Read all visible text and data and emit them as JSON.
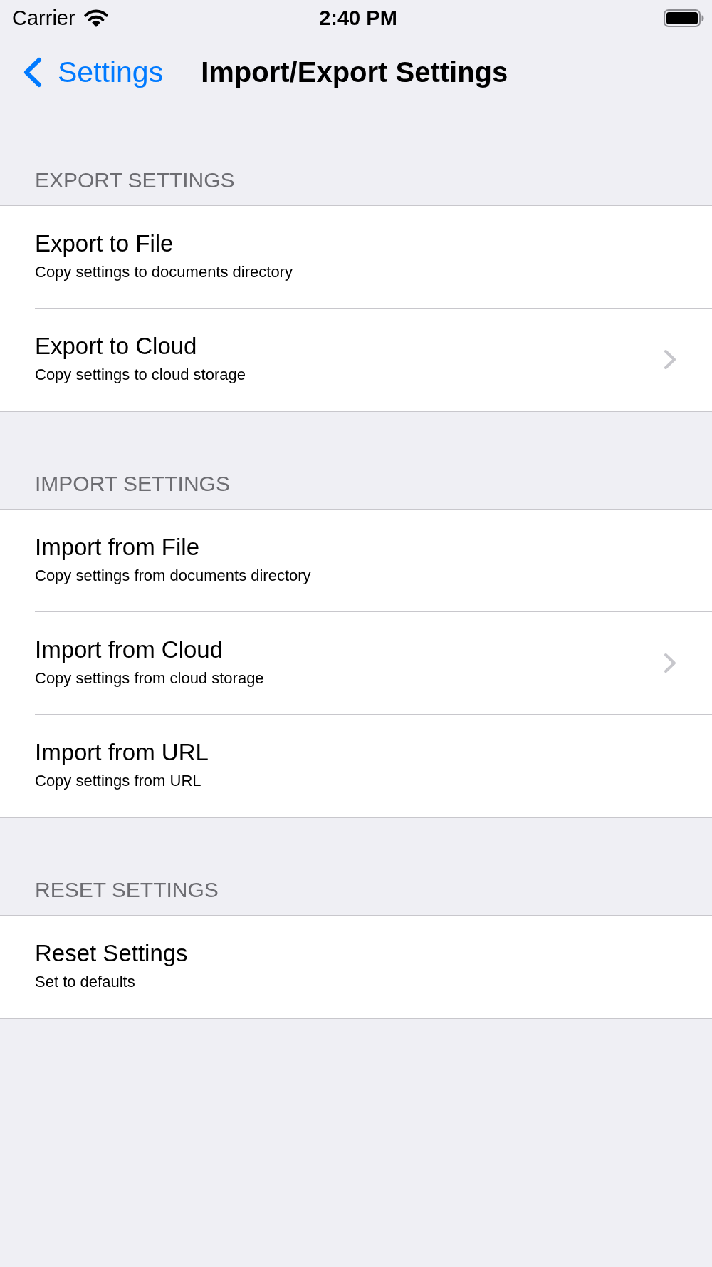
{
  "status_bar": {
    "carrier": "Carrier",
    "time": "2:40 PM"
  },
  "nav_bar": {
    "back_label": "Settings",
    "title": "Import/Export Settings"
  },
  "sections": [
    {
      "header": "EXPORT SETTINGS",
      "rows": [
        {
          "title": "Export to File",
          "subtitle": "Copy settings to documents directory",
          "disclosure": false
        },
        {
          "title": "Export to Cloud",
          "subtitle": "Copy settings to cloud storage",
          "disclosure": true
        }
      ]
    },
    {
      "header": "IMPORT SETTINGS",
      "rows": [
        {
          "title": "Import from File",
          "subtitle": "Copy settings from documents directory",
          "disclosure": false
        },
        {
          "title": "Import from Cloud",
          "subtitle": "Copy settings from cloud storage",
          "disclosure": true
        },
        {
          "title": "Import from URL",
          "subtitle": "Copy settings from URL",
          "disclosure": false
        }
      ]
    },
    {
      "header": "RESET SETTINGS",
      "rows": [
        {
          "title": "Reset Settings",
          "subtitle": "Set to defaults",
          "disclosure": false
        }
      ]
    }
  ]
}
